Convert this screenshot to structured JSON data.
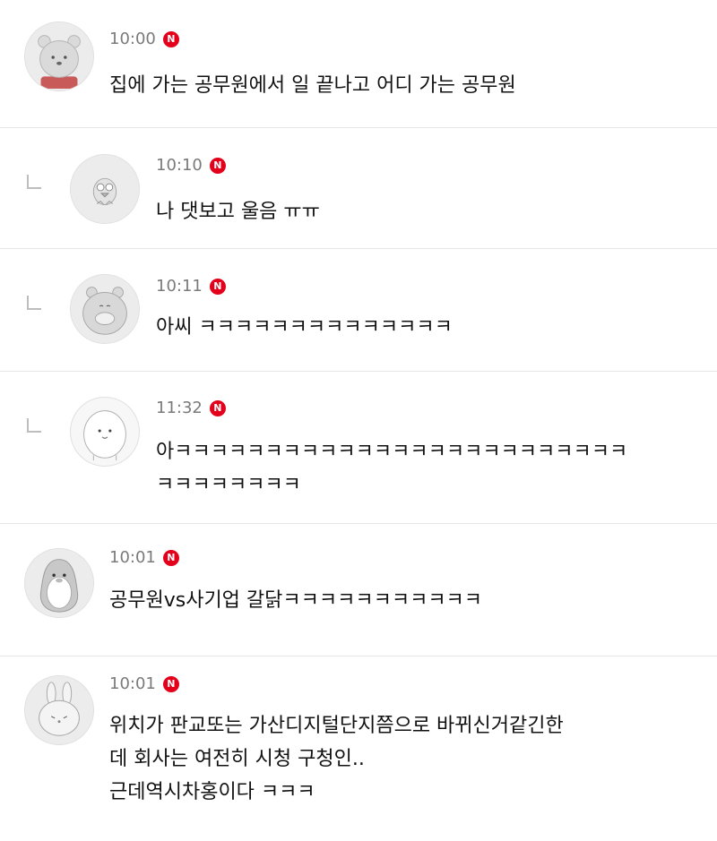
{
  "comments": [
    {
      "time": "10:00",
      "badge": "N",
      "text": "집에 가는 공무원에서 일 끝나고 어디 가는 공무원",
      "avatar_icon": "bear-avatar-icon"
    },
    {
      "time": "10:10",
      "badge": "N",
      "text": "나 댓보고 울음 ㅠㅠ",
      "avatar_icon": "bird-avatar-icon"
    },
    {
      "time": "10:11",
      "badge": "N",
      "text": "아씨 ㅋㅋㅋㅋㅋㅋㅋㅋㅋㅋㅋㅋㅋㅋ",
      "avatar_icon": "hamster-avatar-icon"
    },
    {
      "time": "11:32",
      "badge": "N",
      "text": "아ㅋㅋㅋㅋㅋㅋㅋㅋㅋㅋㅋㅋㅋㅋㅋㅋㅋㅋㅋㅋㅋㅋㅋㅋㅋ\nㅋㅋㅋㅋㅋㅋㅋㅋ",
      "avatar_icon": "blob-avatar-icon"
    },
    {
      "time": "10:01",
      "badge": "N",
      "text": "공무원vs사기업 갈닭ㅋㅋㅋㅋㅋㅋㅋㅋㅋㅋㅋ",
      "avatar_icon": "penguin-avatar-icon"
    },
    {
      "time": "10:01",
      "badge": "N",
      "text": "위치가 판교또는 가산디지털단지쯤으로 바뀌신거같긴한\n데 회사는 여전히 시청 구청인..\n근데역시차홍이다 ㅋㅋㅋ",
      "avatar_icon": "rabbit-avatar-icon"
    }
  ]
}
